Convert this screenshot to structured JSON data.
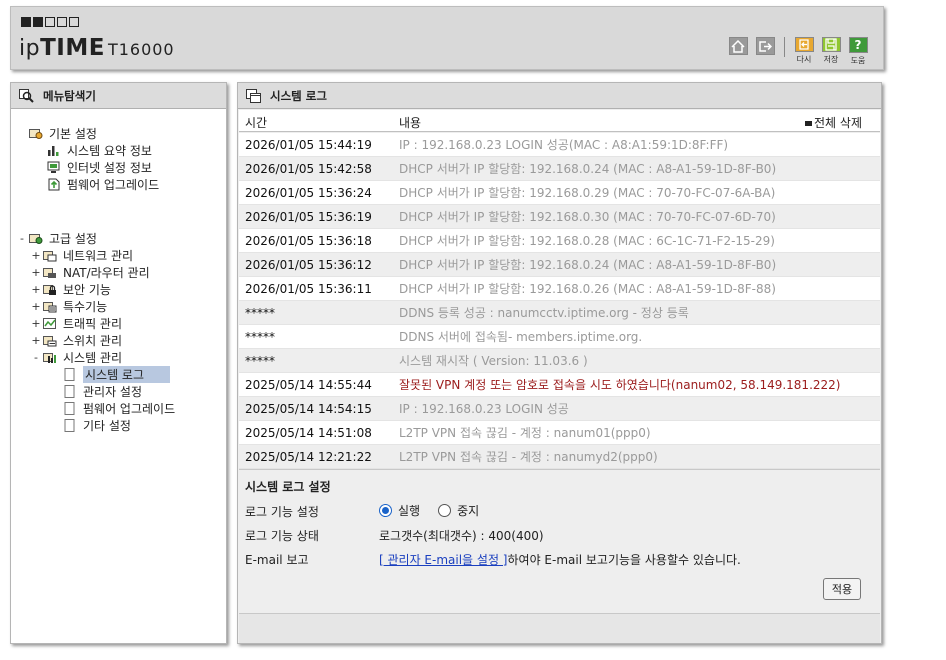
{
  "header": {
    "model": "T16000",
    "icons": [
      {
        "name": "home-icon",
        "caption": "",
        "color": "#9a9a9a"
      },
      {
        "name": "logout-icon",
        "caption": "",
        "color": "#9a9a9a"
      },
      {
        "name": "restore-icon",
        "caption": "다시",
        "color": "#e8a830"
      },
      {
        "name": "save-icon",
        "caption": "저장",
        "color": "#8fc630"
      },
      {
        "name": "help-icon",
        "caption": "도움",
        "color": "#3f9a3a"
      }
    ]
  },
  "menu": {
    "title": "메뉴탐색기",
    "basic": {
      "label": "기본 설정",
      "items": [
        "시스템 요약 정보",
        "인터넷 설정 정보",
        "펌웨어 업그레이드"
      ]
    },
    "advanced": {
      "label": "고급 설정",
      "toggle": "-",
      "groups": [
        {
          "label": "네트워크 관리",
          "toggle": "+"
        },
        {
          "label": "NAT/라우터 관리",
          "toggle": "+"
        },
        {
          "label": "보안 기능",
          "toggle": "+"
        },
        {
          "label": "특수기능",
          "toggle": "+"
        },
        {
          "label": "트래픽 관리",
          "toggle": "+"
        },
        {
          "label": "스위치 관리",
          "toggle": "+"
        },
        {
          "label": "시스템 관리",
          "toggle": "-"
        }
      ],
      "system_items": [
        "시스템 로그",
        "관리자 설정",
        "펌웨어 업그레이드",
        "기타 설정"
      ],
      "selected": "시스템 로그"
    }
  },
  "log": {
    "title": "시스템 로그",
    "col_time": "시간",
    "col_content": "내용",
    "clear_all": "전체 삭제",
    "rows": [
      {
        "time": "2026/01/05 15:44:19",
        "content": "IP : 192.168.0.23 LOGIN 성공(MAC : A8:A1:59:1D:8F:FF)",
        "error": false
      },
      {
        "time": "2026/01/05 15:42:58",
        "content": "DHCP 서버가 IP 할당함: 192.168.0.24 (MAC : A8-A1-59-1D-8F-B0)",
        "error": false
      },
      {
        "time": "2026/01/05 15:36:24",
        "content": "DHCP 서버가 IP 할당함: 192.168.0.29 (MAC : 70-70-FC-07-6A-BA)",
        "error": false
      },
      {
        "time": "2026/01/05 15:36:19",
        "content": "DHCP 서버가 IP 할당함: 192.168.0.30 (MAC : 70-70-FC-07-6D-70)",
        "error": false
      },
      {
        "time": "2026/01/05 15:36:18",
        "content": "DHCP 서버가 IP 할당함: 192.168.0.28 (MAC : 6C-1C-71-F2-15-29)",
        "error": false
      },
      {
        "time": "2026/01/05 15:36:12",
        "content": "DHCP 서버가 IP 할당함: 192.168.0.24 (MAC : A8-A1-59-1D-8F-B0)",
        "error": false
      },
      {
        "time": "2026/01/05 15:36:11",
        "content": "DHCP 서버가 IP 할당함: 192.168.0.26 (MAC : A8-A1-59-1D-8F-88)",
        "error": false
      },
      {
        "time": "*****",
        "content": "DDNS 등록 성공 : nanumcctv.iptime.org - 정상 등록",
        "error": false
      },
      {
        "time": "*****",
        "content": "DDNS 서버에 접속됨- members.iptime.org.",
        "error": false
      },
      {
        "time": "*****",
        "content": "시스템 재시작 ( Version: 11.03.6 )",
        "error": false
      },
      {
        "time": "2025/05/14 14:55:44",
        "content": "잘못된 VPN 계정 또는 암호로 접속을 시도 하였습니다(nanum02, 58.149.181.222)",
        "error": true
      },
      {
        "time": "2025/05/14 14:54:15",
        "content": "IP : 192.168.0.23 LOGIN 성공",
        "error": false
      },
      {
        "time": "2025/05/14 14:51:08",
        "content": "L2TP VPN 접속 끊김 - 계정 : nanum01(ppp0)",
        "error": false
      },
      {
        "time": "2025/05/14 12:21:22",
        "content": "L2TP VPN 접속 끊김 - 계정 : nanumyd2(ppp0)",
        "error": false
      }
    ]
  },
  "settings": {
    "title": "시스템 로그 설정",
    "log_function_label": "로그 기능 설정",
    "run_label": "실행",
    "stop_label": "중지",
    "selected": "실행",
    "log_status_label": "로그 기능 상태",
    "log_status_value": "로그갯수(최대갯수) : 400(400)",
    "email_label": "E-mail 보고",
    "email_link": "[ 관리자 E-mail을 설정 ]",
    "email_suffix": "하여야 E-mail 보고기능을 사용할수 있습니다.",
    "apply_label": "적용"
  }
}
